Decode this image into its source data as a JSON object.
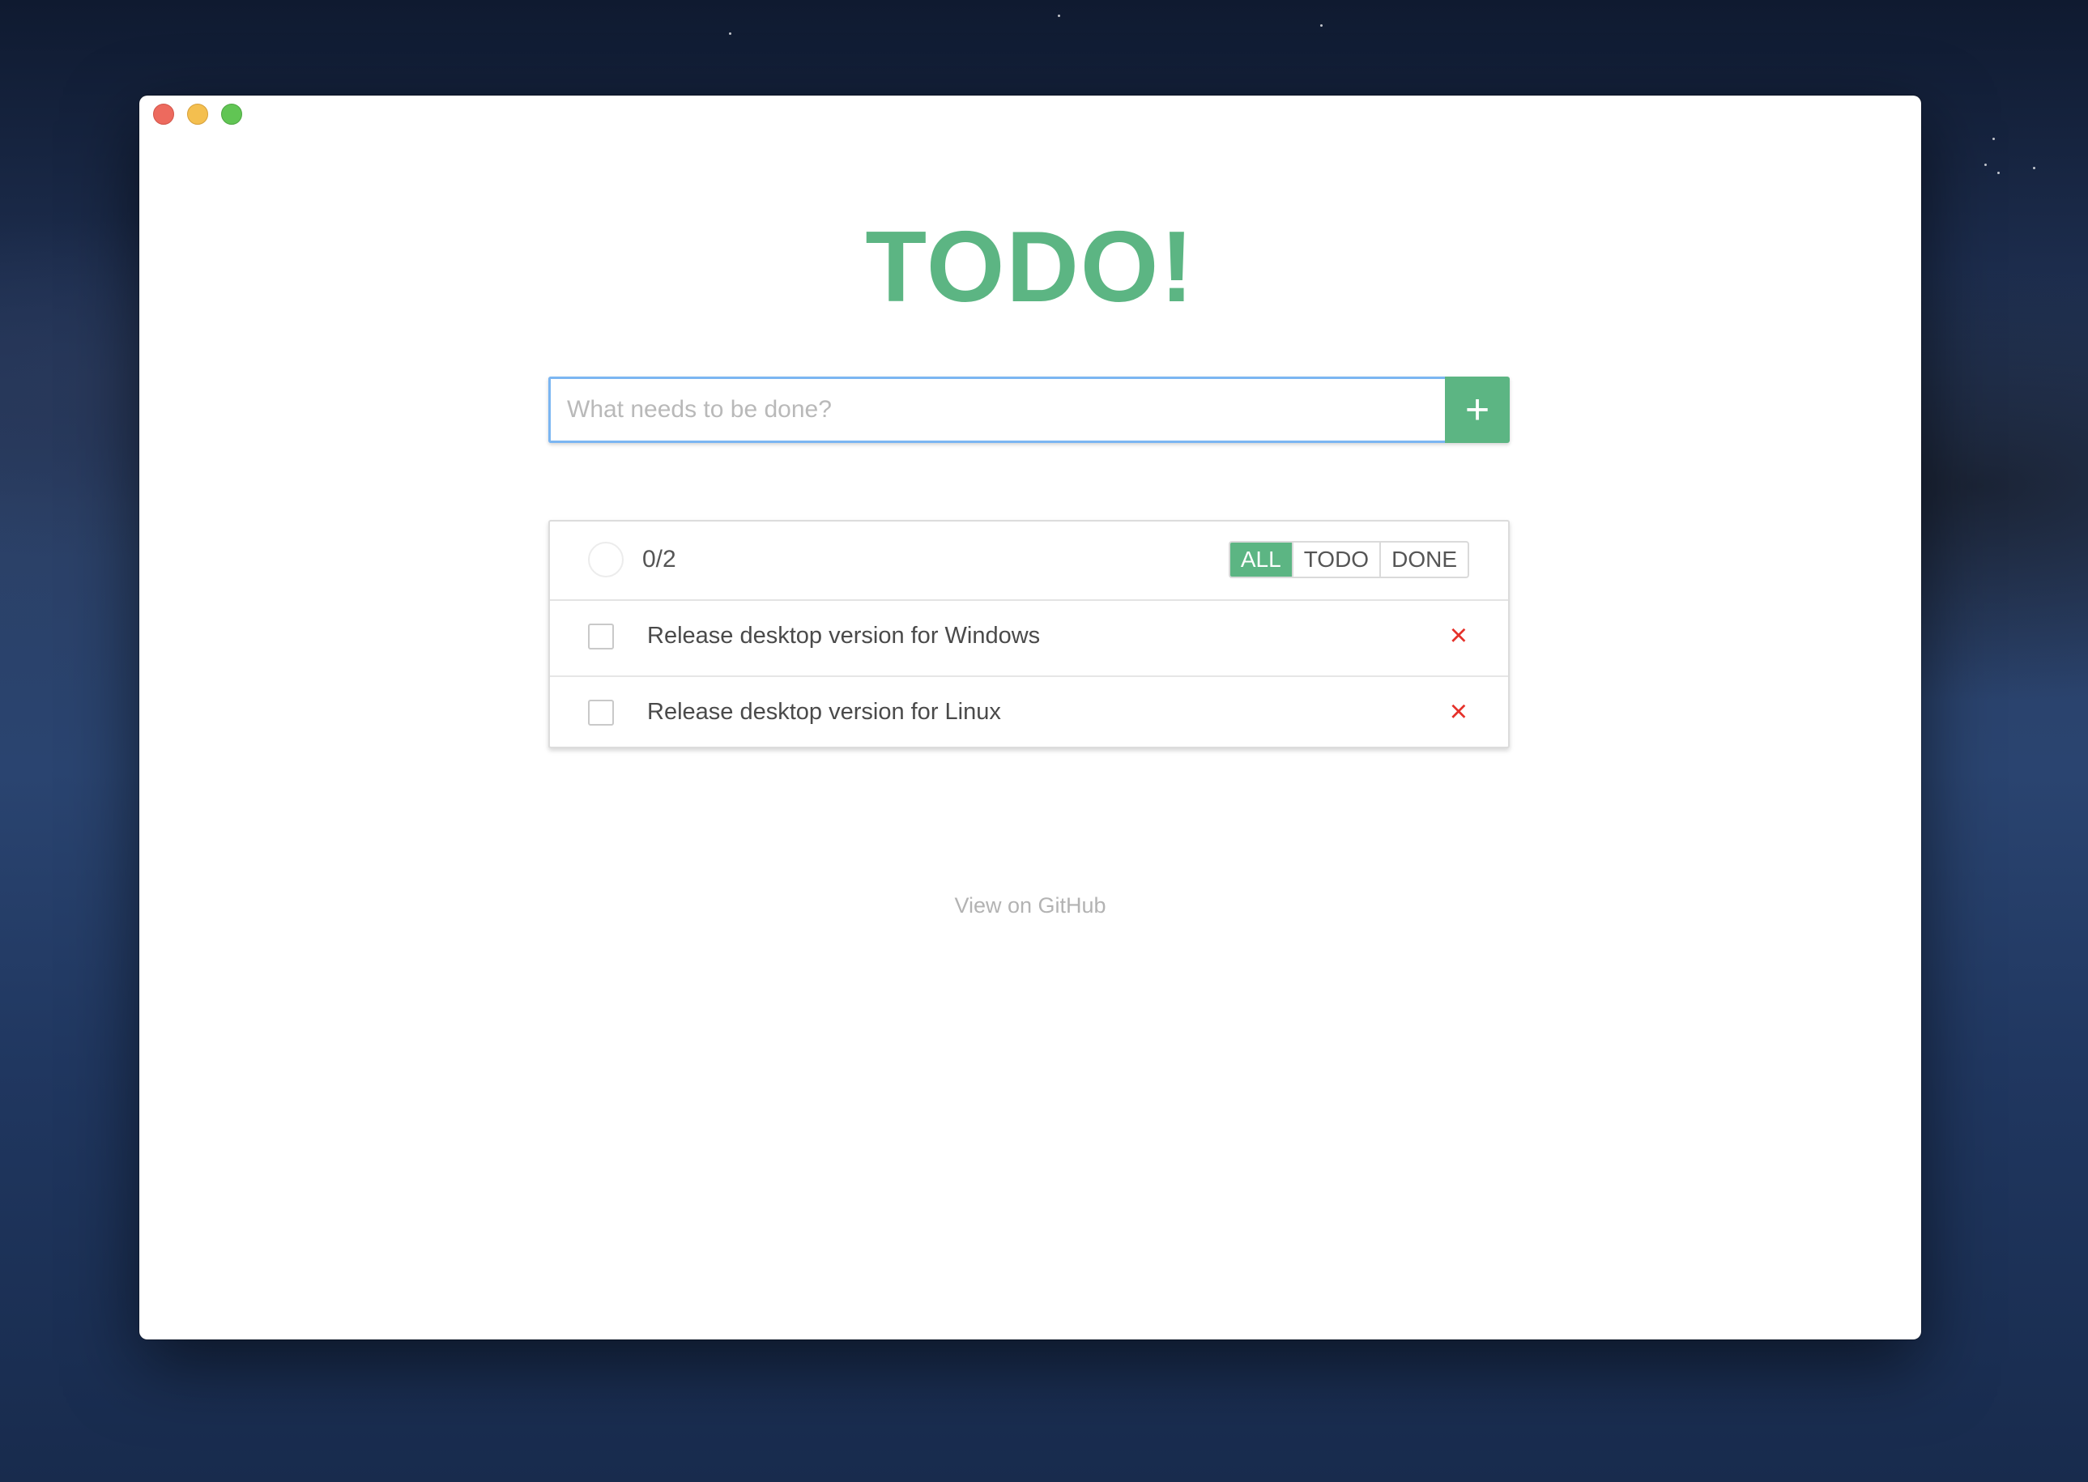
{
  "window": {
    "traffic_lights": [
      "close",
      "minimize",
      "maximize"
    ]
  },
  "app": {
    "title": "TODO!",
    "colors": {
      "accent": "#5cb583",
      "delete": "#e5312a",
      "focus_ring": "#7bb6f2"
    }
  },
  "add_form": {
    "input_value": "",
    "input_placeholder": "What needs to be done?",
    "add_button_label": "+"
  },
  "list": {
    "progress": "0/2",
    "filters": [
      {
        "label": "ALL",
        "active": true
      },
      {
        "label": "TODO",
        "active": false
      },
      {
        "label": "DONE",
        "active": false
      }
    ],
    "items": [
      {
        "text": "Release desktop version for Windows",
        "done": false,
        "delete_label": "×"
      },
      {
        "text": "Release desktop version for Linux",
        "done": false,
        "delete_label": "×"
      }
    ]
  },
  "footer": {
    "github_link": "View on GitHub"
  }
}
